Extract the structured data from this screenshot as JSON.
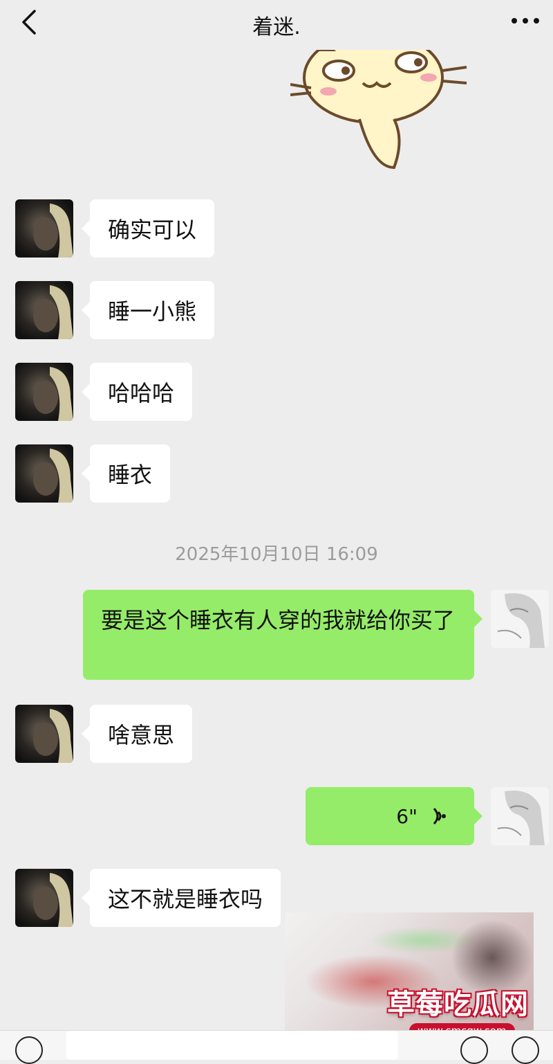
{
  "header": {
    "title": "着迷.",
    "back_icon": "chevron-left-icon",
    "more_icon": "more-dots-icon"
  },
  "messages": [
    {
      "side": "left",
      "text": "确实可以"
    },
    {
      "side": "left",
      "text": "睡一小熊"
    },
    {
      "side": "left",
      "text": "哈哈哈"
    },
    {
      "side": "left",
      "text": "睡衣"
    },
    {
      "side": "right",
      "text": "要是这个睡衣有人穿的我就给你买了"
    },
    {
      "side": "left",
      "text": "啥意思"
    },
    {
      "side": "right",
      "voice": "6\""
    },
    {
      "side": "left",
      "text": "这不就是睡衣吗"
    }
  ],
  "timestamp": "2025年10月10日 16:09",
  "watermark": {
    "brand": "草莓吃瓜网",
    "url": "www.cmcgw.com"
  },
  "colors": {
    "background": "#ededed",
    "bubble_left": "#ffffff",
    "bubble_right": "#95ec69",
    "timestamp": "#9b9b9b"
  }
}
